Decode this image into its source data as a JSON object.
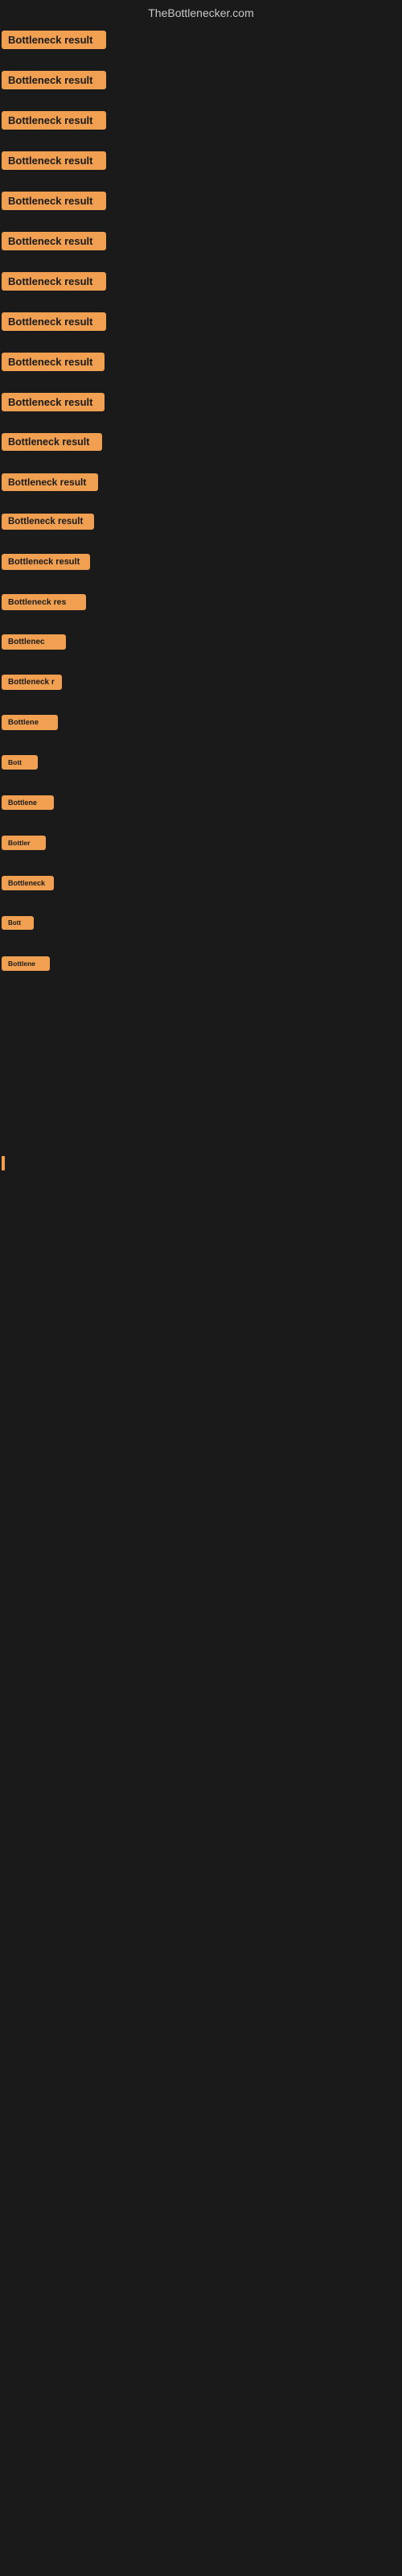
{
  "header": {
    "title": "TheBottlenecker.com"
  },
  "rows": [
    {
      "id": 1,
      "label": "Bottleneck result",
      "class": "row-1"
    },
    {
      "id": 2,
      "label": "Bottleneck result",
      "class": "row-2"
    },
    {
      "id": 3,
      "label": "Bottleneck result",
      "class": "row-3"
    },
    {
      "id": 4,
      "label": "Bottleneck result",
      "class": "row-4"
    },
    {
      "id": 5,
      "label": "Bottleneck result",
      "class": "row-5"
    },
    {
      "id": 6,
      "label": "Bottleneck result",
      "class": "row-6"
    },
    {
      "id": 7,
      "label": "Bottleneck result",
      "class": "row-7"
    },
    {
      "id": 8,
      "label": "Bottleneck result",
      "class": "row-8"
    },
    {
      "id": 9,
      "label": "Bottleneck result",
      "class": "row-9"
    },
    {
      "id": 10,
      "label": "Bottleneck result",
      "class": "row-10"
    },
    {
      "id": 11,
      "label": "Bottleneck result",
      "class": "row-11"
    },
    {
      "id": 12,
      "label": "Bottleneck result",
      "class": "row-12"
    },
    {
      "id": 13,
      "label": "Bottleneck result",
      "class": "row-13"
    },
    {
      "id": 14,
      "label": "Bottleneck result",
      "class": "row-14"
    },
    {
      "id": 15,
      "label": "Bottleneck res",
      "class": "row-15"
    },
    {
      "id": 16,
      "label": "Bottlenec",
      "class": "row-16"
    },
    {
      "id": 17,
      "label": "Bottleneck r",
      "class": "row-17"
    },
    {
      "id": 18,
      "label": "Bottlene",
      "class": "row-18"
    },
    {
      "id": 19,
      "label": "Bott",
      "class": "row-19"
    },
    {
      "id": 20,
      "label": "Bottlene",
      "class": "row-20"
    },
    {
      "id": 21,
      "label": "Bottler",
      "class": "row-21"
    },
    {
      "id": 22,
      "label": "Bottleneck",
      "class": "row-22"
    },
    {
      "id": 23,
      "label": "Bott",
      "class": "row-23"
    },
    {
      "id": 24,
      "label": "Bottlene",
      "class": "row-24"
    }
  ],
  "colors": {
    "accent": "#f0a050",
    "background": "#1a1a1a",
    "text_light": "#c8c8c8"
  }
}
